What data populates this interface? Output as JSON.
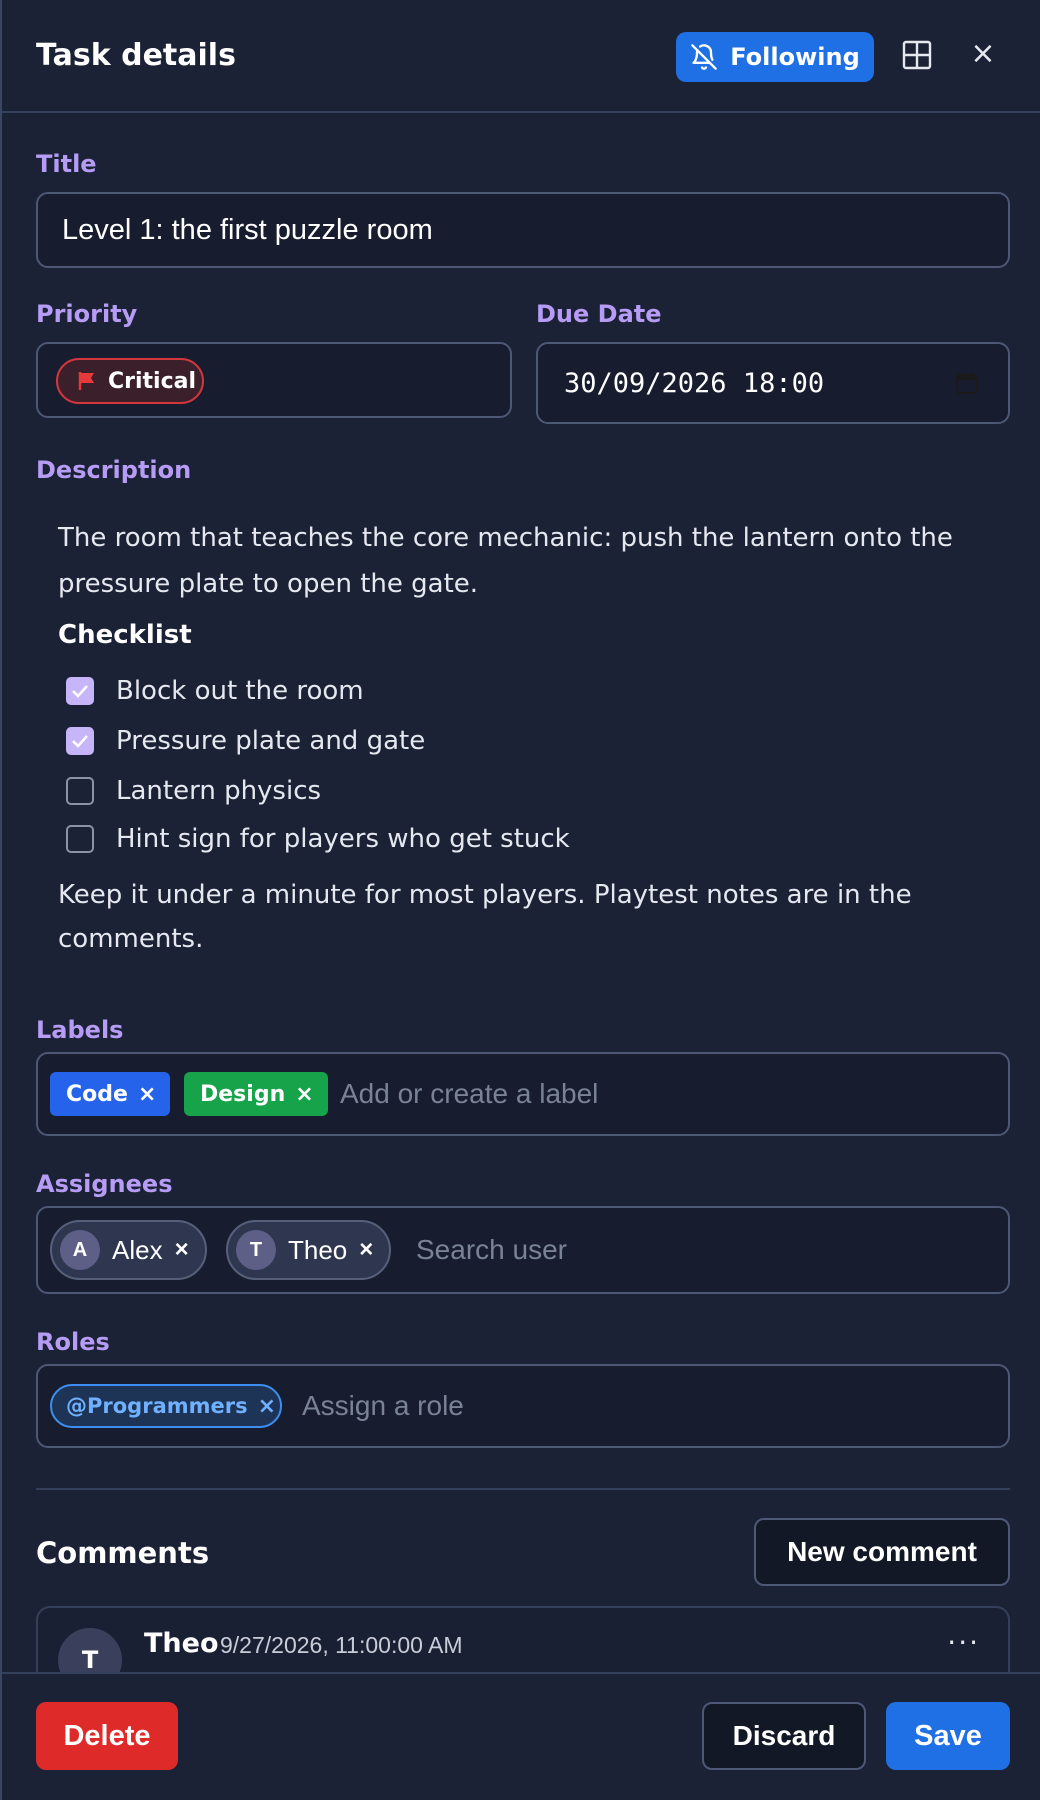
{
  "header": {
    "title": "Task details",
    "follow_label": "Following",
    "close_glyph": "×"
  },
  "fields": {
    "title_label": "Title",
    "title_value": "Level 1: the first puzzle room",
    "priority_label": "Priority",
    "priority_value": "Critical",
    "priority_color": "#d3363c",
    "due_label": "Due Date",
    "due_value": "30/09/2026 18:00",
    "description_label": "Description"
  },
  "description": {
    "intro": "The room that teaches the core mechanic: push the lantern onto the pressure plate to open the gate.",
    "checklist_heading": "Checklist",
    "checklist": [
      {
        "label": "Block out the room",
        "checked": true
      },
      {
        "label": "Pressure plate and gate",
        "checked": true
      },
      {
        "label": "Lantern physics",
        "checked": false
      },
      {
        "label": "Hint sign for players who get stuck",
        "checked": false
      }
    ],
    "outro": "Keep it under a minute for most players. Playtest notes are in the comments."
  },
  "labels": {
    "label": "Labels",
    "chips": [
      {
        "name": "Code",
        "color": "#2563eb"
      },
      {
        "name": "Design",
        "color": "#16a34a"
      }
    ],
    "placeholder": "Add or create a label"
  },
  "assignees": {
    "label": "Assignees",
    "users": [
      {
        "initial": "A",
        "name": "Alex"
      },
      {
        "initial": "T",
        "name": "Theo"
      }
    ],
    "placeholder": "Search user"
  },
  "roles": {
    "label": "Roles",
    "chips": [
      "@Programmers"
    ],
    "placeholder": "Assign a role"
  },
  "comments": {
    "title": "Comments",
    "new_button": "New comment",
    "items": [
      {
        "initial": "T",
        "author": "Theo",
        "time": "9/27/2026, 11:00:00 AM"
      }
    ]
  },
  "footer": {
    "delete_label": "Delete",
    "discard_label": "Discard",
    "save_label": "Save"
  },
  "icons": {
    "follow": "bell-off-icon",
    "layout": "layout-grid-icon",
    "close": "close-icon",
    "priority": "flag-icon",
    "date": "calendar-icon",
    "remove": "x-icon",
    "more": "more-horizontal-icon"
  },
  "colors": {
    "accent": "#1f6fe5",
    "danger": "#df2a2a",
    "label_heading": "#b69cf5",
    "checkbox_checked": "#c7b5fa",
    "background": "#1b2236"
  }
}
